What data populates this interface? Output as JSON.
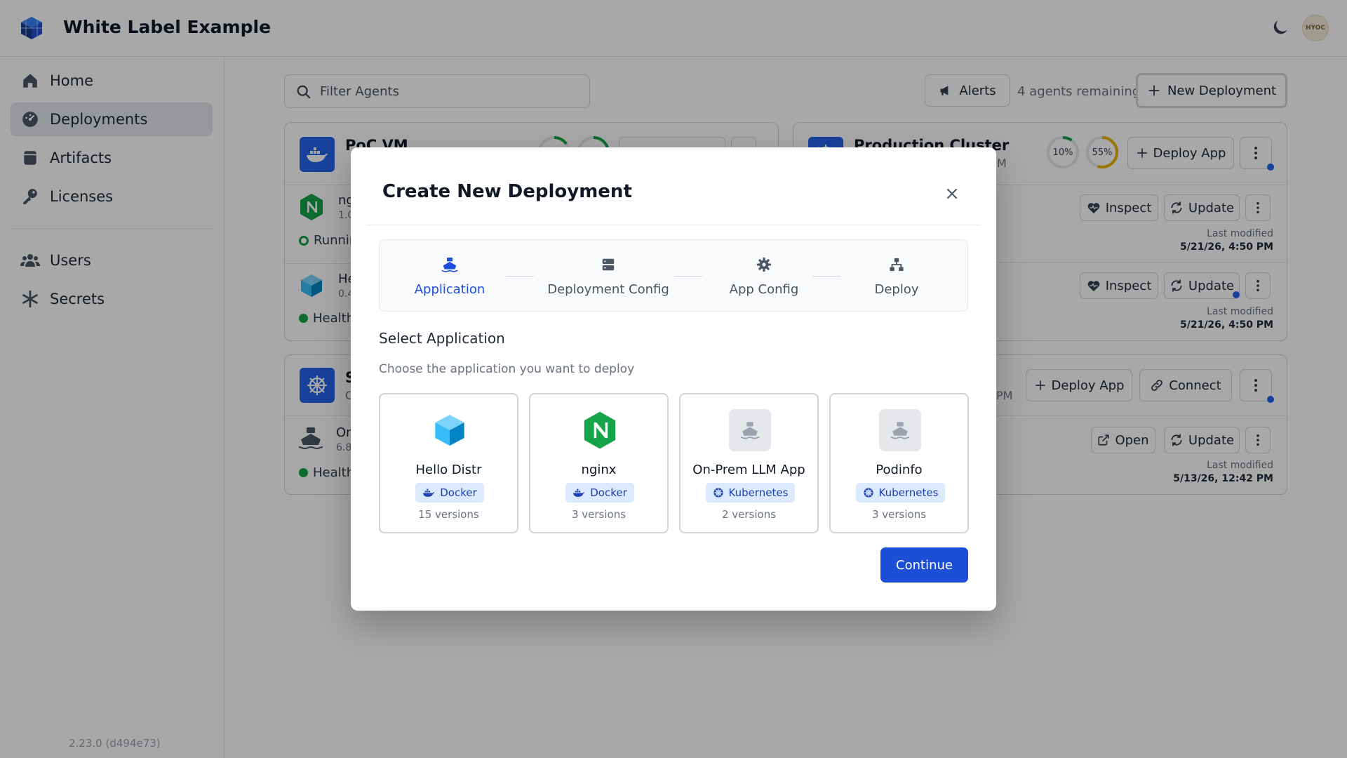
{
  "header": {
    "title": "White Label Example",
    "avatar_text": "HYOC"
  },
  "sidebar": {
    "items": [
      {
        "label": "Home",
        "icon": "home-icon"
      },
      {
        "label": "Deployments",
        "icon": "dashboard-icon"
      },
      {
        "label": "Artifacts",
        "icon": "artifact-icon"
      },
      {
        "label": "Licenses",
        "icon": "key-icon"
      },
      {
        "label": "Users",
        "icon": "users-icon"
      },
      {
        "label": "Secrets",
        "icon": "asterisk-icon"
      }
    ],
    "version": "2.23.0 (d494e73)"
  },
  "toolbar": {
    "filter_placeholder": "Filter Agents",
    "alerts_label": "Alerts",
    "agents_remaining": "4 agents remaining",
    "new_deployment_label": "New Deployment"
  },
  "cards": {
    "poc_vm": {
      "title": "PoC VM",
      "rows": [
        {
          "name": "ng",
          "version": "1.0",
          "status": "Runnin"
        },
        {
          "name": "He",
          "version": "0.4",
          "status": "Health"
        }
      ]
    },
    "production": {
      "title": "Production Cluster",
      "subtitle_tail": "M",
      "gauges": [
        {
          "label": "10%",
          "value": 10
        },
        {
          "label": "55%",
          "value": 55
        }
      ],
      "deploy_app_label": "Deploy App",
      "rows": [
        {
          "inspect": "Inspect",
          "update": "Update",
          "lm_label": "Last modified",
          "lm_date": "5/21/26, 4:50 PM"
        },
        {
          "inspect": "Inspect",
          "update": "Update",
          "lm_label": "Last modified",
          "lm_date": "5/21/26, 4:50 PM"
        }
      ]
    },
    "third": {
      "title": "S",
      "subtitle_head": "C",
      "subtitle_tail": "PM",
      "deploy_app_label": "Deploy App",
      "connect_label": "Connect",
      "rows": [
        {
          "name": "On",
          "version": "6.8",
          "status": "Health",
          "open": "Open",
          "update": "Update",
          "lm_label": "Last modified",
          "lm_date": "5/13/26, 12:42 PM"
        }
      ]
    }
  },
  "modal": {
    "title": "Create New Deployment",
    "steps": [
      {
        "label": "Application",
        "icon": "ship-icon",
        "active": true
      },
      {
        "label": "Deployment Config",
        "icon": "server-icon",
        "active": false
      },
      {
        "label": "App Config",
        "icon": "gear-icon",
        "active": false
      },
      {
        "label": "Deploy",
        "icon": "network-icon",
        "active": false
      }
    ],
    "section_title": "Select Application",
    "section_subtitle": "Choose the application you want to deploy",
    "apps": [
      {
        "name": "Hello Distr",
        "type": "Docker",
        "versions": "15 versions",
        "icon": "cube-icon"
      },
      {
        "name": "nginx",
        "type": "Docker",
        "versions": "3 versions",
        "icon": "nginx-icon"
      },
      {
        "name": "On-Prem LLM App",
        "type": "Kubernetes",
        "versions": "2 versions",
        "icon": "ship-icon"
      },
      {
        "name": "Podinfo",
        "type": "Kubernetes",
        "versions": "3 versions",
        "icon": "ship-icon"
      }
    ],
    "continue_label": "Continue"
  },
  "colors": {
    "accent": "#1d4ed8",
    "badge_bg": "#dbeafe",
    "status_green": "#16a34a"
  }
}
